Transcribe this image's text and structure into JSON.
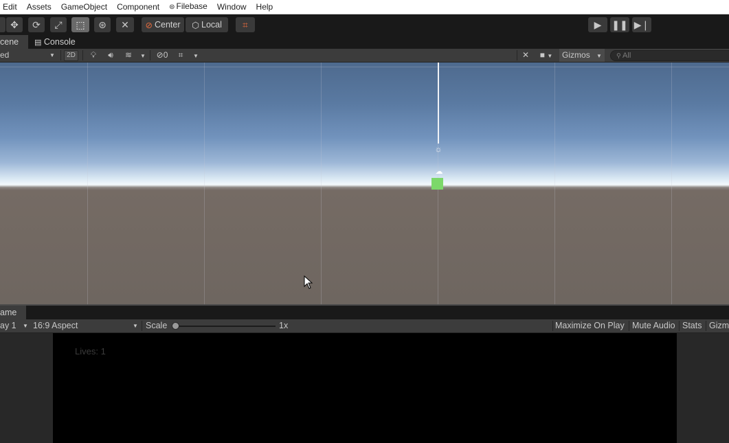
{
  "menu": {
    "items": [
      "Edit",
      "Assets",
      "GameObject",
      "Component",
      "Filebase",
      "Window",
      "Help"
    ],
    "filebase_icon": "filebase-logo-icon"
  },
  "toolbar": {
    "tools": [
      "move-tool-icon",
      "rotate-tool-icon",
      "scale-tool-icon",
      "rect-tool-icon",
      "transform-tool-icon",
      "custom-tool-icon"
    ],
    "active_tool": "rect-tool-icon",
    "pivot_label": "Center",
    "space_label": "Local",
    "play_controls": [
      "play-icon",
      "pause-icon",
      "step-icon"
    ]
  },
  "tabs": {
    "scene": "cene",
    "console": "Console"
  },
  "scene_toolbar": {
    "draw_mode": "ed",
    "btn_2d": "2D",
    "hidden_count": "0",
    "gizmos_label": "Gizmos",
    "search_placeholder": "All"
  },
  "game": {
    "tab_label": "ame",
    "display_label": "ay 1",
    "aspect_label": "16:9 Aspect",
    "scale_label": "Scale",
    "scale_value": "1x",
    "scale_fraction": 0.0,
    "maximize_label": "Maximize On Play",
    "mute_label": "Mute Audio",
    "stats_label": "Stats",
    "gizmos_label": "Gizm",
    "lives_text": "Lives: 1"
  },
  "colors": {
    "accent_orange": "#e46a3c",
    "cube_green": "#7cd86a",
    "panel_bg": "#3c3c3c",
    "toolbar_bg": "#191919"
  }
}
